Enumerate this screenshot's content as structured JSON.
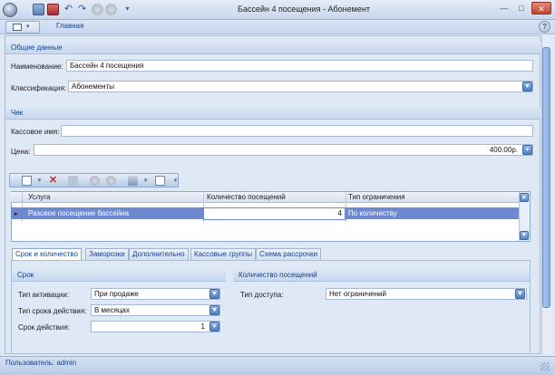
{
  "window": {
    "title": "Бассейн 4 посещения - Абонемент",
    "minimize_glyph": "—",
    "maximize_glyph": "□",
    "close_glyph": "✕"
  },
  "ribbon": {
    "tabs": [
      {
        "label": "Главная"
      }
    ],
    "help_glyph": "?"
  },
  "general": {
    "header": "Общие данные",
    "name_label": "Наименование:",
    "name_value": "Бассейн 4 посещения",
    "class_label": "Классификация:",
    "class_value": "Абонементы"
  },
  "receipt": {
    "header": "Чек",
    "cash_name_label": "Кассовое имя:",
    "cash_name_value": "",
    "price_label": "Цена:",
    "price_value": "400.00р."
  },
  "toolbar": {
    "icons": [
      "new-icon",
      "delete-icon",
      "copy-icon",
      "up-icon",
      "down-icon",
      "print-icon",
      "edit-icon"
    ],
    "delete_glyph": "✕"
  },
  "grid": {
    "columns": [
      "Услуга",
      "Количество посещений",
      "Тип ограничения"
    ],
    "rows": [
      {
        "service": "Разовое посещение бассейна",
        "count": "4",
        "limit": "По количеству"
      }
    ],
    "row_marker": "▸"
  },
  "tabs": [
    {
      "label": "Срок и количество",
      "active": true
    },
    {
      "label": "Заморозки",
      "active": false
    },
    {
      "label": "Дополнительно",
      "active": false
    },
    {
      "label": "Кассовые группы",
      "active": false
    },
    {
      "label": "Схема рассрочки",
      "active": false
    }
  ],
  "term": {
    "header": "Срок",
    "activation_label": "Тип активации:",
    "activation_value": "При продаже",
    "term_type_label": "Тип срока действия:",
    "term_type_value": "В месяцах",
    "term_label": "Срок действия:",
    "term_value": "1"
  },
  "visits": {
    "header": "Количество посещений",
    "access_label": "Тип доступа:",
    "access_value": "Нет ограничений"
  },
  "status": {
    "user_text": "Пользователь: admin"
  },
  "colors": {
    "accent": "#15428b",
    "selected_row": "#6d89cf"
  }
}
